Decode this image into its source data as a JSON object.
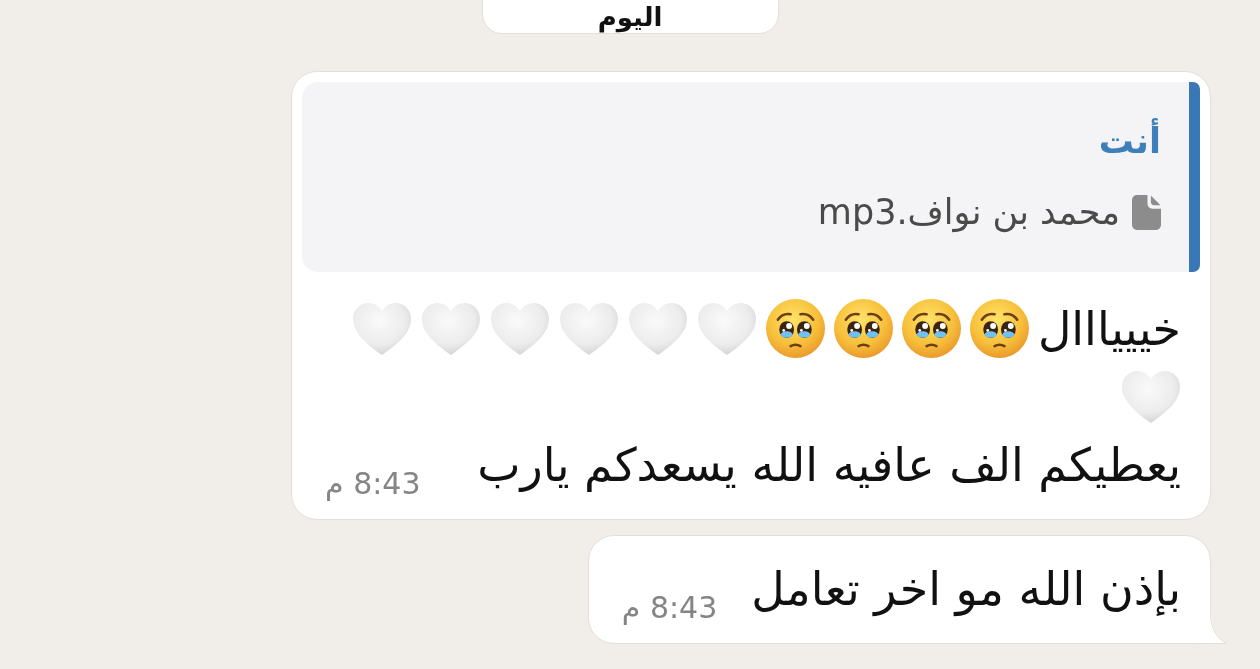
{
  "date_divider": {
    "label": "اليوم"
  },
  "messages": [
    {
      "quote": {
        "sender": "أنت",
        "attachment": {
          "kind": "file",
          "name": "محمد بن نواف.mp3"
        }
      },
      "lines": [
        [
          {
            "kind": "text",
            "text": "خيييااال"
          },
          {
            "kind": "teary_face"
          },
          {
            "kind": "teary_face"
          },
          {
            "kind": "teary_face"
          },
          {
            "kind": "teary_face"
          },
          {
            "kind": "heart"
          },
          {
            "kind": "heart"
          },
          {
            "kind": "heart"
          },
          {
            "kind": "heart"
          },
          {
            "kind": "heart"
          },
          {
            "kind": "heart"
          },
          {
            "kind": "heart"
          }
        ],
        [
          {
            "kind": "text",
            "text": "يعطيكم الف عافيه الله يسعدكم يارب"
          }
        ]
      ],
      "time": "8:43 م",
      "tail": false
    },
    {
      "lines": [
        [
          {
            "kind": "text",
            "text": "بإذن الله مو اخر تعامل"
          }
        ]
      ],
      "time": "8:43 م",
      "tail": true
    }
  ]
}
